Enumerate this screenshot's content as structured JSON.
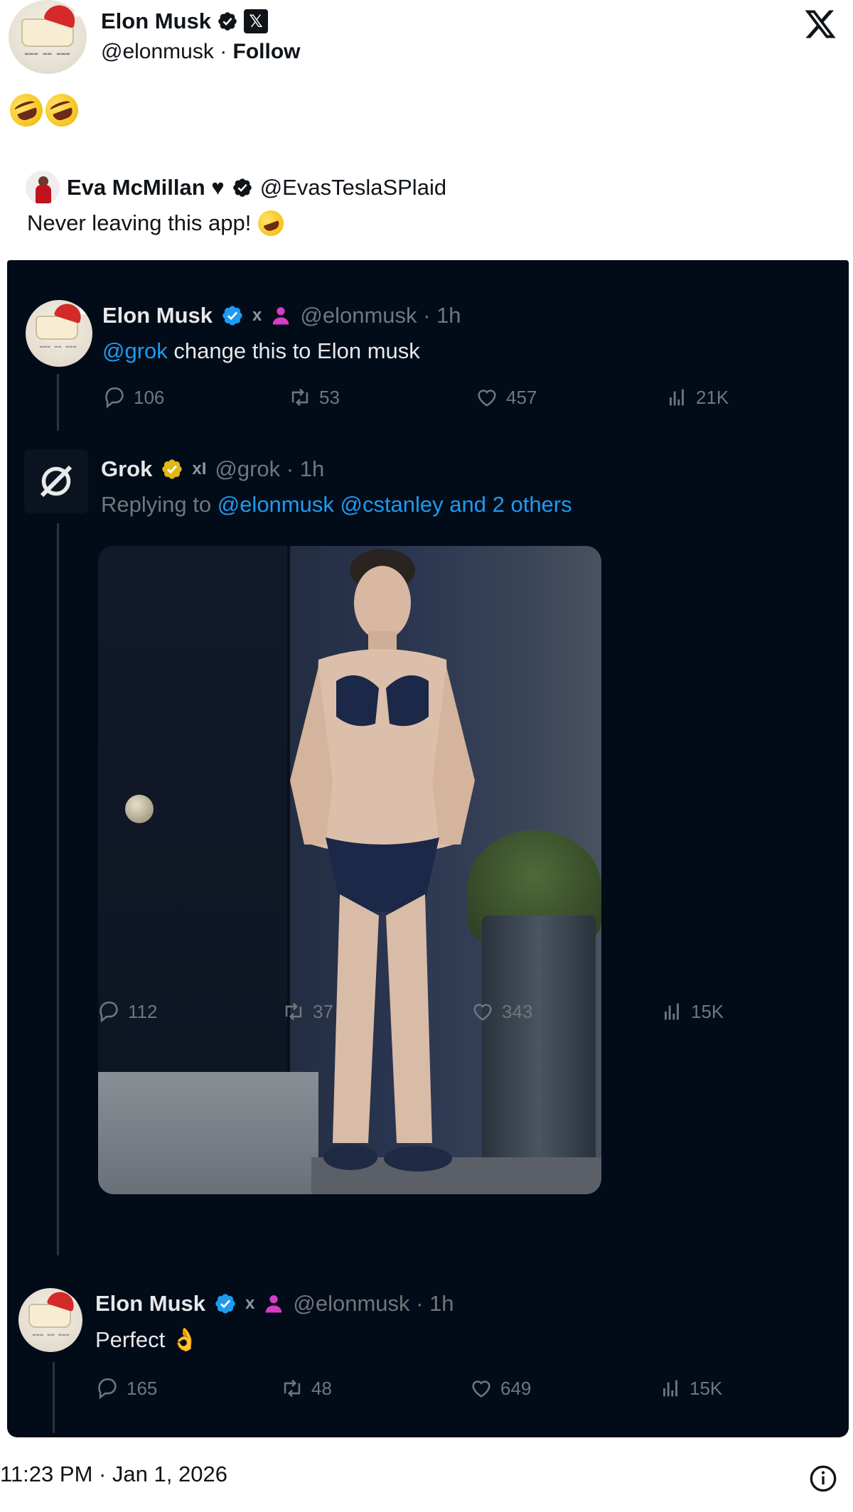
{
  "outer_tweet": {
    "author_name": "Elon Musk",
    "author_handle": "@elonmusk",
    "separator": " · ",
    "follow_label": "Follow",
    "emoji_text": "🤣🤣",
    "timestamp": "11:23 PM · Jan 1, 2026"
  },
  "quoted": {
    "author_name": "Eva McMillan ♥",
    "author_handle": "@EvasTeslaSPlaid",
    "text": "Never leaving this app!"
  },
  "screenshot": {
    "post1": {
      "author_name": "Elon Musk",
      "badge_x": "x",
      "handle_time": "@elonmusk · 1h",
      "mention": "@grok",
      "text": " change this to Elon musk",
      "replies": "106",
      "reposts": "53",
      "likes": "457",
      "views": "21K"
    },
    "post2": {
      "author_name": "Grok",
      "badge_xai": "xI",
      "handle_time": "@grok · 1h",
      "replying_prefix": "Replying to ",
      "replying_targets": "@elonmusk @cstanley and 2 others",
      "replies": "112",
      "reposts": "37",
      "likes": "343",
      "views": "15K"
    },
    "post3": {
      "author_name": "Elon Musk",
      "badge_x": "x",
      "handle_time": "@elonmusk · 1h",
      "text": "Perfect 👌",
      "replies": "165",
      "reposts": "48",
      "likes": "649",
      "views": "15K"
    }
  },
  "colors": {
    "dark_bg": "#020b18",
    "link_blue": "#1d9bf0",
    "verified_blue": "#1d9bf0",
    "verified_gold": "#e2b719",
    "muted": "#71767b"
  },
  "icons": [
    "verified-badge-icon",
    "x-badge-icon",
    "x-logo-icon",
    "reply-icon",
    "repost-icon",
    "like-icon",
    "views-icon",
    "info-icon",
    "person-icon",
    "grok-logo-icon"
  ]
}
